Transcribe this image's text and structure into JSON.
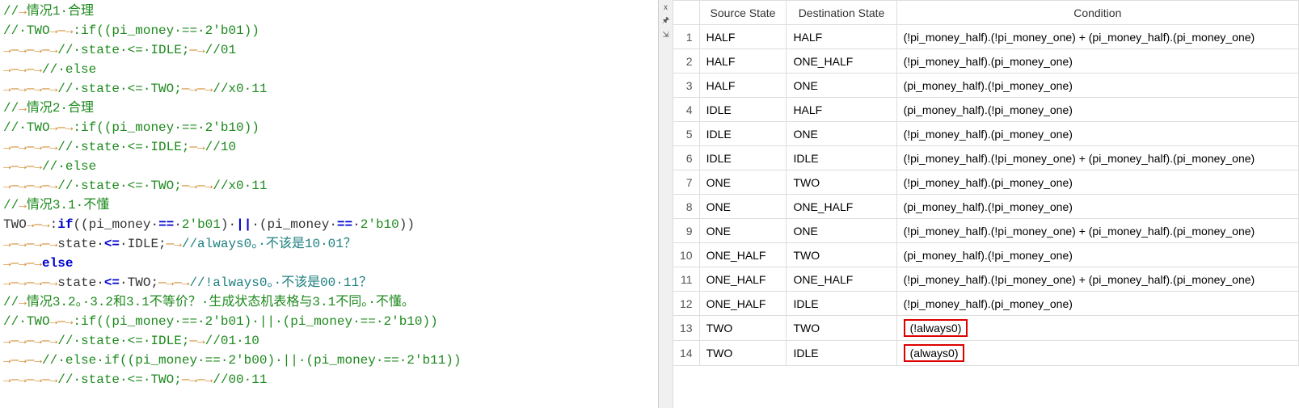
{
  "editor": {
    "lines": [
      [
        {
          "cls": "cmt",
          "t": "//"
        },
        {
          "cls": "arrow",
          "t": "→"
        },
        {
          "cls": "cmt",
          "t": "情况1·合理"
        }
      ],
      [
        {
          "cls": "cmt",
          "t": "//·TWO"
        },
        {
          "cls": "arrow",
          "t": "→——→"
        },
        {
          "cls": "cmt",
          "t": ":if((pi_money·==·2'b01))"
        }
      ],
      [
        {
          "cls": "arrow",
          "t": "→——→——→——→"
        },
        {
          "cls": "cmt",
          "t": "//·state·<=·IDLE;"
        },
        {
          "cls": "arrow",
          "t": "——→"
        },
        {
          "cls": "cmt",
          "t": "//01"
        }
      ],
      [
        {
          "cls": "arrow",
          "t": "→——→——→"
        },
        {
          "cls": "cmt",
          "t": "//·else"
        }
      ],
      [
        {
          "cls": "arrow",
          "t": "→——→——→——→"
        },
        {
          "cls": "cmt",
          "t": "//·state·<=·TWO;"
        },
        {
          "cls": "arrow",
          "t": "——→——→"
        },
        {
          "cls": "cmt",
          "t": "//x0·11"
        }
      ],
      [
        {
          "cls": "cmt",
          "t": "//"
        },
        {
          "cls": "arrow",
          "t": "→"
        },
        {
          "cls": "cmt",
          "t": "情况2·合理"
        }
      ],
      [
        {
          "cls": "cmt",
          "t": "//·TWO"
        },
        {
          "cls": "arrow",
          "t": "→——→"
        },
        {
          "cls": "cmt",
          "t": ":if((pi_money·==·2'b10))"
        }
      ],
      [
        {
          "cls": "arrow",
          "t": "→——→——→——→"
        },
        {
          "cls": "cmt",
          "t": "//·state·<=·IDLE;"
        },
        {
          "cls": "arrow",
          "t": "——→"
        },
        {
          "cls": "cmt",
          "t": "//10"
        }
      ],
      [
        {
          "cls": "arrow",
          "t": "→——→——→"
        },
        {
          "cls": "cmt",
          "t": "//·else"
        }
      ],
      [
        {
          "cls": "arrow",
          "t": "→——→——→——→"
        },
        {
          "cls": "cmt",
          "t": "//·state·<=·TWO;"
        },
        {
          "cls": "arrow",
          "t": "——→——→"
        },
        {
          "cls": "cmt",
          "t": "//x0·11"
        }
      ],
      [
        {
          "cls": "cmt",
          "t": "//"
        },
        {
          "cls": "arrow",
          "t": "→"
        },
        {
          "cls": "cmt",
          "t": "情况3.1·不懂"
        }
      ],
      [
        {
          "cls": "txt",
          "t": "TWO"
        },
        {
          "cls": "arrow",
          "t": "→——→"
        },
        {
          "cls": "punc",
          "t": ":"
        },
        {
          "cls": "kw",
          "t": "if"
        },
        {
          "cls": "punc",
          "t": "((pi_money·"
        },
        {
          "cls": "op",
          "t": "=="
        },
        {
          "cls": "punc",
          "t": "·"
        },
        {
          "cls": "num",
          "t": "2'b01"
        },
        {
          "cls": "punc",
          "t": ")·"
        },
        {
          "cls": "op",
          "t": "||"
        },
        {
          "cls": "punc",
          "t": "·(pi_money·"
        },
        {
          "cls": "op",
          "t": "=="
        },
        {
          "cls": "punc",
          "t": "·"
        },
        {
          "cls": "num",
          "t": "2'b10"
        },
        {
          "cls": "punc",
          "t": "))"
        }
      ],
      [
        {
          "cls": "arrow",
          "t": "→——→——→——→"
        },
        {
          "cls": "txt",
          "t": "state·"
        },
        {
          "cls": "op",
          "t": "<="
        },
        {
          "cls": "txt",
          "t": "·IDLE;"
        },
        {
          "cls": "arrow",
          "t": "——→"
        },
        {
          "cls": "teal",
          "t": "//always0。·不该是10·01？"
        }
      ],
      [
        {
          "cls": "arrow",
          "t": "→——→——→"
        },
        {
          "cls": "kw",
          "t": "else"
        }
      ],
      [
        {
          "cls": "arrow",
          "t": "→——→——→——→"
        },
        {
          "cls": "txt",
          "t": "state·"
        },
        {
          "cls": "op",
          "t": "<="
        },
        {
          "cls": "txt",
          "t": "·TWO;"
        },
        {
          "cls": "arrow",
          "t": "——→——→"
        },
        {
          "cls": "teal",
          "t": "//!always0。·不该是00·11？"
        }
      ],
      [
        {
          "cls": "cmt",
          "t": "//"
        },
        {
          "cls": "arrow",
          "t": "→"
        },
        {
          "cls": "cmt",
          "t": "情况3.2。·3.2和3.1不等价？·生成状态机表格与3.1不同。·不懂。"
        }
      ],
      [
        {
          "cls": "cmt",
          "t": "//·TWO"
        },
        {
          "cls": "arrow",
          "t": "→——→"
        },
        {
          "cls": "cmt",
          "t": ":if((pi_money·==·2'b01)·||·(pi_money·==·2'b10))"
        }
      ],
      [
        {
          "cls": "arrow",
          "t": "→——→——→——→"
        },
        {
          "cls": "cmt",
          "t": "//·state·<=·IDLE;"
        },
        {
          "cls": "arrow",
          "t": "——→"
        },
        {
          "cls": "cmt",
          "t": "//01·10"
        }
      ],
      [
        {
          "cls": "arrow",
          "t": "→——→——→"
        },
        {
          "cls": "cmt",
          "t": "//·else·if((pi_money·==·2'b00)·||·(pi_money·==·2'b11))"
        }
      ],
      [
        {
          "cls": "arrow",
          "t": "→——→——→——→"
        },
        {
          "cls": "cmt",
          "t": "//·state·<=·TWO;"
        },
        {
          "cls": "arrow",
          "t": "——→——→"
        },
        {
          "cls": "cmt",
          "t": "//00·11"
        }
      ]
    ]
  },
  "table": {
    "headers": [
      "Source State",
      "Destination State",
      "Condition"
    ],
    "rows": [
      {
        "n": "1",
        "src": "HALF",
        "dst": "HALF",
        "cond": "(!pi_money_half).(!pi_money_one) + (pi_money_half).(pi_money_one)",
        "hl": false
      },
      {
        "n": "2",
        "src": "HALF",
        "dst": "ONE_HALF",
        "cond": "(!pi_money_half).(pi_money_one)",
        "hl": false
      },
      {
        "n": "3",
        "src": "HALF",
        "dst": "ONE",
        "cond": "(pi_money_half).(!pi_money_one)",
        "hl": false
      },
      {
        "n": "4",
        "src": "IDLE",
        "dst": "HALF",
        "cond": "(pi_money_half).(!pi_money_one)",
        "hl": false
      },
      {
        "n": "5",
        "src": "IDLE",
        "dst": "ONE",
        "cond": "(!pi_money_half).(pi_money_one)",
        "hl": false
      },
      {
        "n": "6",
        "src": "IDLE",
        "dst": "IDLE",
        "cond": "(!pi_money_half).(!pi_money_one) + (pi_money_half).(pi_money_one)",
        "hl": false
      },
      {
        "n": "7",
        "src": "ONE",
        "dst": "TWO",
        "cond": "(!pi_money_half).(pi_money_one)",
        "hl": false
      },
      {
        "n": "8",
        "src": "ONE",
        "dst": "ONE_HALF",
        "cond": "(pi_money_half).(!pi_money_one)",
        "hl": false
      },
      {
        "n": "9",
        "src": "ONE",
        "dst": "ONE",
        "cond": "(!pi_money_half).(!pi_money_one) + (pi_money_half).(pi_money_one)",
        "hl": false
      },
      {
        "n": "10",
        "src": "ONE_HALF",
        "dst": "TWO",
        "cond": "(pi_money_half).(!pi_money_one)",
        "hl": false
      },
      {
        "n": "11",
        "src": "ONE_HALF",
        "dst": "ONE_HALF",
        "cond": "(!pi_money_half).(!pi_money_one) + (pi_money_half).(pi_money_one)",
        "hl": false
      },
      {
        "n": "12",
        "src": "ONE_HALF",
        "dst": "IDLE",
        "cond": "(!pi_money_half).(pi_money_one)",
        "hl": false
      },
      {
        "n": "13",
        "src": "TWO",
        "dst": "TWO",
        "cond": "(!always0)",
        "hl": true
      },
      {
        "n": "14",
        "src": "TWO",
        "dst": "IDLE",
        "cond": "(always0)",
        "hl": true
      }
    ]
  },
  "toolbar": {
    "close": "x",
    "pin": "🖈",
    "dock": "⇲"
  }
}
